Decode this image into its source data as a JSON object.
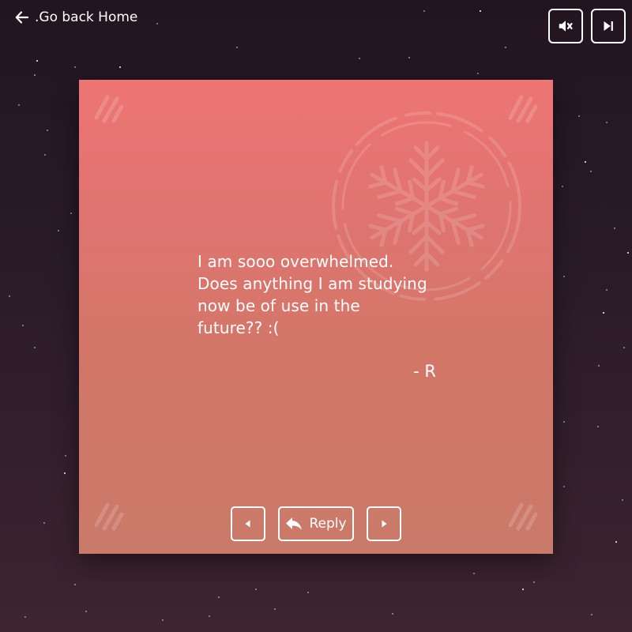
{
  "header": {
    "back_label": ".Go back Home",
    "back_icon": "arrow-left-icon",
    "mute_icon": "volume-mute-icon",
    "skip_icon": "skip-next-icon"
  },
  "card": {
    "message": "I am sooo overwhelmed.\nDoes anything I am studying\nnow be of use in the\nfuture?? :(",
    "signature": "- R",
    "decoration_icon": "snowflake-icon",
    "colors": {
      "top": "#ed7573",
      "bottom": "#ca7a6a"
    }
  },
  "controls": {
    "prev_icon": "caret-left-icon",
    "reply_label": "Reply",
    "reply_icon": "reply-arrow-icon",
    "next_icon": "caret-right-icon"
  },
  "theme": {
    "background": "#2b1b29",
    "foreground": "#ffffff"
  }
}
